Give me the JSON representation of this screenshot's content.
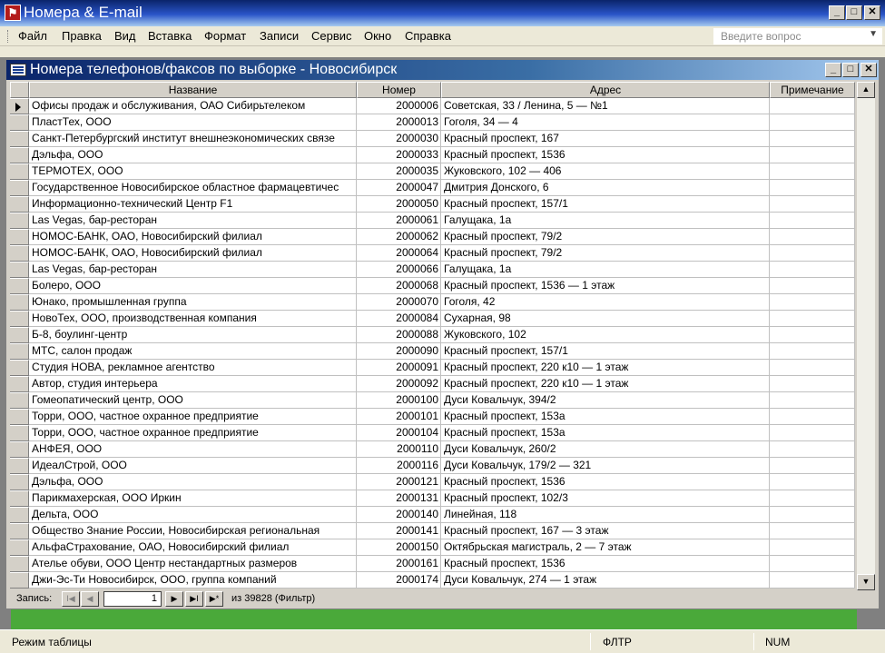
{
  "app": {
    "title": "Номера & E-mail",
    "icon": "access-app-icon"
  },
  "window_buttons": {
    "minimize": "_",
    "restore": "□",
    "close": "✕"
  },
  "menu": {
    "items": [
      "Файл",
      "Правка",
      "Вид",
      "Вставка",
      "Формат",
      "Записи",
      "Сервис",
      "Окно",
      "Справка"
    ],
    "help_placeholder": "Введите вопрос"
  },
  "child": {
    "title": "Номера телефонов/факсов по выборке - Новосибирск",
    "icon": "datasheet-icon"
  },
  "table": {
    "columns": [
      "Название",
      "Номер",
      "Адрес",
      "Примечание"
    ],
    "rows": [
      [
        "Офисы продаж и обслуживания, ОАО Сибирьтелеком",
        "2000006",
        "Советская, 33 / Ленина, 5 — №1",
        ""
      ],
      [
        "ПластТех, ООО",
        "2000013",
        "Гоголя, 34 — 4",
        ""
      ],
      [
        "Санкт-Петербургский институт внешнеэкономических связе",
        "2000030",
        "Красный проспект, 167",
        ""
      ],
      [
        "Дэльфа, ООО",
        "2000033",
        "Красный проспект, 1536",
        ""
      ],
      [
        "ТЕРМОТЕХ, ООО",
        "2000035",
        "Жуковского, 102 — 406",
        ""
      ],
      [
        "Государственное Новосибирское областное фармацевтичес",
        "2000047",
        "Дмитрия Донского, 6",
        ""
      ],
      [
        "Информационно-технический Центр F1",
        "2000050",
        "Красный проспект, 157/1",
        ""
      ],
      [
        "Las Vegas, бар-ресторан",
        "2000061",
        "Галущака, 1а",
        ""
      ],
      [
        "НОМОС-БАНК, ОАО, Новосибирский филиал",
        "2000062",
        "Красный проспект, 79/2",
        ""
      ],
      [
        "НОМОС-БАНК, ОАО, Новосибирский филиал",
        "2000064",
        "Красный проспект, 79/2",
        ""
      ],
      [
        "Las Vegas, бар-ресторан",
        "2000066",
        "Галущака, 1а",
        ""
      ],
      [
        "Болеро, ООО",
        "2000068",
        "Красный проспект, 1536 — 1 этаж",
        ""
      ],
      [
        "Юнако, промышленная группа",
        "2000070",
        "Гоголя, 42",
        ""
      ],
      [
        "НовоТех, ООО, производственная компания",
        "2000084",
        "Сухарная, 98",
        ""
      ],
      [
        "Б-8, боулинг-центр",
        "2000088",
        "Жуковского, 102",
        ""
      ],
      [
        "МТС, салон продаж",
        "2000090",
        "Красный проспект, 157/1",
        ""
      ],
      [
        "Студия НОВА, рекламное агентство",
        "2000091",
        "Красный проспект, 220 к10 — 1 этаж",
        ""
      ],
      [
        "Автор, студия интерьера",
        "2000092",
        "Красный проспект, 220 к10 — 1 этаж",
        ""
      ],
      [
        "Гомеопатический центр, ООО",
        "2000100",
        "Дуси Ковальчук, 394/2",
        ""
      ],
      [
        "Торри, ООО, частное охранное предприятие",
        "2000101",
        "Красный проспект, 153а",
        ""
      ],
      [
        "Торри, ООО, частное охранное предприятие",
        "2000104",
        "Красный проспект, 153а",
        ""
      ],
      [
        "АНФЕЯ, ООО",
        "2000110",
        "Дуси Ковальчук, 260/2",
        ""
      ],
      [
        "ИдеалСтрой, ООО",
        "2000116",
        "Дуси Ковальчук, 179/2 — 321",
        ""
      ],
      [
        "Дэльфа, ООО",
        "2000121",
        "Красный проспект, 1536",
        ""
      ],
      [
        "Парикмахерская, ООО Иркин",
        "2000131",
        "Красный проспект, 102/3",
        ""
      ],
      [
        "Дельта, ООО",
        "2000140",
        "Линейная, 118",
        ""
      ],
      [
        "Общество Знание России, Новосибирская региональная",
        "2000141",
        "Красный проспект, 167 — 3 этаж",
        ""
      ],
      [
        "АльфаСтрахование, ОАО, Новосибирский филиал",
        "2000150",
        "Октябрьская магистраль, 2 — 7 этаж",
        ""
      ],
      [
        "Ателье обуви, ООО Центр нестандартных размеров",
        "2000161",
        "Красный проспект, 1536",
        ""
      ],
      [
        "Джи-Эс-Ти Новосибирск, ООО, группа компаний",
        "2000174",
        "Дуси Ковальчук, 274 — 1 этаж",
        ""
      ]
    ]
  },
  "navigator": {
    "label": "Запись:",
    "current": "1",
    "of_text": "из  39828 (Фильтр)",
    "buttons": [
      "I◀",
      "◀",
      "▶",
      "▶I",
      "▶*"
    ]
  },
  "scrollbar": {
    "up": "▲",
    "down": "▼"
  },
  "status": {
    "mode": "Режим таблицы",
    "filter": "ФЛТР",
    "num": "NUM"
  },
  "colors": {
    "title_bar": "#0a246a",
    "background_form": "#4aa93a",
    "mdi": "#808080"
  }
}
